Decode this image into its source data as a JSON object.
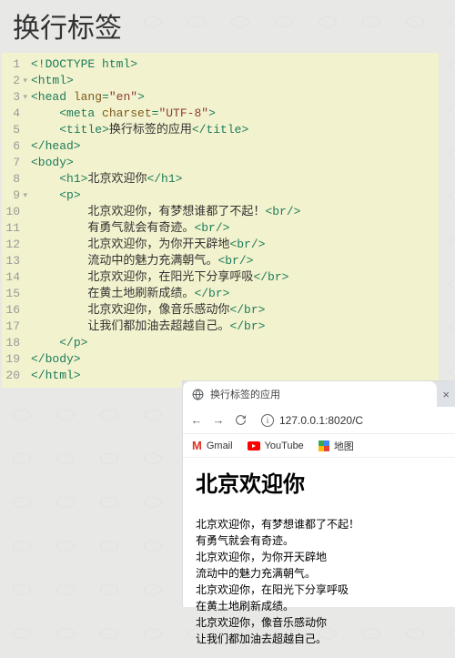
{
  "page_title": "换行标签",
  "code": {
    "line_count": 20,
    "fold_lines": [
      2,
      3,
      9
    ],
    "lines": [
      {
        "raw": "<!DOCTYPE html>",
        "cls": "doctype"
      },
      {
        "parts": [
          {
            "t": "<html>",
            "c": "tag"
          }
        ]
      },
      {
        "parts": [
          {
            "t": "<head ",
            "c": "tag"
          },
          {
            "t": "lang",
            "c": "attr-name"
          },
          {
            "t": "=",
            "c": "tag"
          },
          {
            "t": "\"en\"",
            "c": "attr-val"
          },
          {
            "t": ">",
            "c": "tag"
          }
        ]
      },
      {
        "indent": "    ",
        "parts": [
          {
            "t": "<meta ",
            "c": "tag"
          },
          {
            "t": "charset",
            "c": "attr-name"
          },
          {
            "t": "=",
            "c": "tag"
          },
          {
            "t": "\"UTF-8\"",
            "c": "attr-val"
          },
          {
            "t": ">",
            "c": "tag"
          }
        ]
      },
      {
        "indent": "    ",
        "parts": [
          {
            "t": "<title>",
            "c": "tag"
          },
          {
            "t": "换行标签的应用",
            "c": ""
          },
          {
            "t": "</title>",
            "c": "tag"
          }
        ]
      },
      {
        "parts": [
          {
            "t": "</head>",
            "c": "tag"
          }
        ]
      },
      {
        "parts": [
          {
            "t": "<body>",
            "c": "tag"
          }
        ]
      },
      {
        "indent": "    ",
        "parts": [
          {
            "t": "<h1>",
            "c": "tag"
          },
          {
            "t": "北京欢迎你",
            "c": ""
          },
          {
            "t": "</h1>",
            "c": "tag"
          }
        ]
      },
      {
        "indent": "    ",
        "parts": [
          {
            "t": "<p>",
            "c": "tag"
          }
        ]
      },
      {
        "indent": "        ",
        "parts": [
          {
            "t": "北京欢迎你，有梦想谁都了不起！",
            "c": ""
          },
          {
            "t": "<br/>",
            "c": "tag"
          }
        ]
      },
      {
        "indent": "        ",
        "parts": [
          {
            "t": "有勇气就会有奇迹。",
            "c": ""
          },
          {
            "t": "<br/>",
            "c": "tag"
          }
        ]
      },
      {
        "indent": "        ",
        "parts": [
          {
            "t": "北京欢迎你，为你开天辟地",
            "c": ""
          },
          {
            "t": "<br/>",
            "c": "tag"
          }
        ]
      },
      {
        "indent": "        ",
        "parts": [
          {
            "t": "流动中的魅力充满朝气。",
            "c": ""
          },
          {
            "t": "<br/>",
            "c": "tag"
          }
        ]
      },
      {
        "indent": "        ",
        "parts": [
          {
            "t": "北京欢迎你，在阳光下分享呼吸",
            "c": ""
          },
          {
            "t": "</br>",
            "c": "tag"
          }
        ]
      },
      {
        "indent": "        ",
        "parts": [
          {
            "t": "在黄土地刷新成绩。",
            "c": ""
          },
          {
            "t": "</br>",
            "c": "tag"
          }
        ]
      },
      {
        "indent": "        ",
        "parts": [
          {
            "t": "北京欢迎你，像音乐感动你",
            "c": ""
          },
          {
            "t": "</br>",
            "c": "tag"
          }
        ]
      },
      {
        "indent": "        ",
        "parts": [
          {
            "t": "让我们都加油去超越自己。",
            "c": ""
          },
          {
            "t": "</br>",
            "c": "tag"
          }
        ]
      },
      {
        "indent": "    ",
        "parts": [
          {
            "t": "</p>",
            "c": "tag"
          }
        ]
      },
      {
        "parts": [
          {
            "t": "</body>",
            "c": "tag"
          }
        ]
      },
      {
        "parts": [
          {
            "t": "</html>",
            "c": "tag"
          }
        ]
      }
    ]
  },
  "preview": {
    "tab_title": "换行标签的应用",
    "url": "127.0.0.1:8020/C",
    "bookmarks": [
      {
        "name": "Gmail"
      },
      {
        "name": "YouTube"
      },
      {
        "name": "地图"
      }
    ],
    "heading": "北京欢迎你",
    "body_lines": [
      "北京欢迎你，有梦想谁都了不起！",
      "有勇气就会有奇迹。",
      "北京欢迎你，为你开天辟地",
      "流动中的魅力充满朝气。",
      "北京欢迎你，在阳光下分享呼吸",
      "在黄土地刷新成绩。",
      "北京欢迎你，像音乐感动你",
      "让我们都加油去超越自己。"
    ]
  }
}
